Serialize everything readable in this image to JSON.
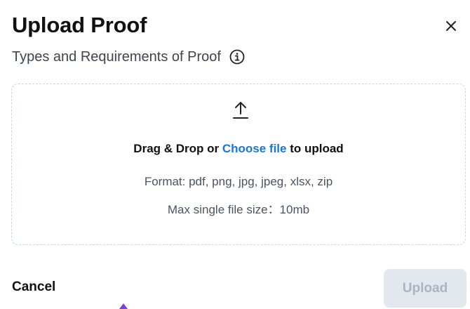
{
  "dialog": {
    "title": "Upload Proof",
    "subtitle": "Types and Requirements of Proof",
    "close_icon": "close-icon",
    "info_icon": "info-icon"
  },
  "dropzone": {
    "upload_icon": "upload-arrow-icon",
    "drag_text_before": "Drag & Drop or ",
    "choose_file_link": "Choose file",
    "drag_text_after": " to upload",
    "format_text": "Format: pdf, png, jpg, jpeg, xlsx, zip",
    "size_text": "Max single file size：10mb"
  },
  "footer": {
    "cancel_label": "Cancel",
    "upload_label": "Upload"
  },
  "colors": {
    "link": "#1976d2",
    "upload_button_bg": "#e3e8ee",
    "upload_button_text": "#a9b4c0"
  }
}
